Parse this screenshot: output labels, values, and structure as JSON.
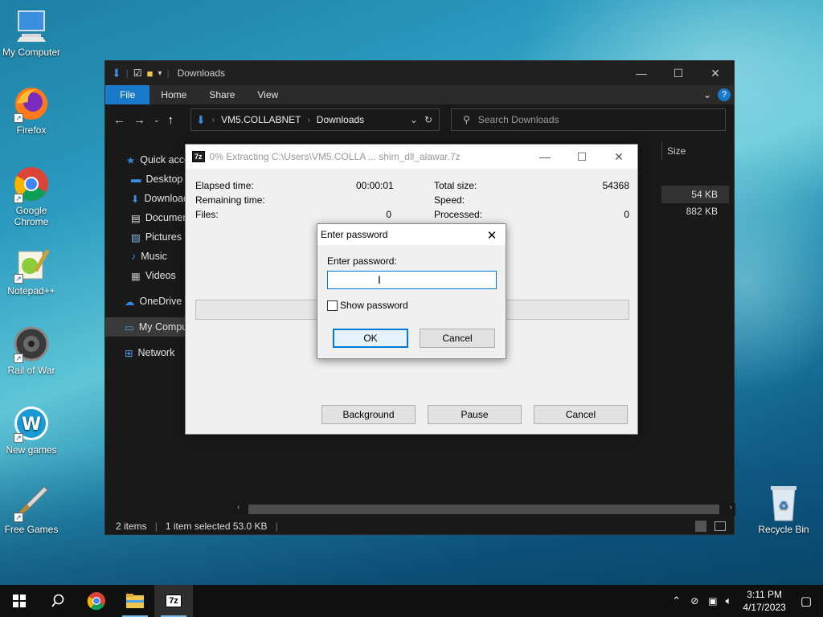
{
  "desktop": {
    "icons": [
      {
        "label": "My Computer"
      },
      {
        "label": "Firefox"
      },
      {
        "label": "Google Chrome"
      },
      {
        "label": "Notepad++"
      },
      {
        "label": "Rail of War"
      },
      {
        "label": "New games"
      },
      {
        "label": "Free Games"
      },
      {
        "label": "Recycle Bin"
      }
    ]
  },
  "explorer": {
    "title": "Downloads",
    "ribbon_tabs": [
      "File",
      "Home",
      "Share",
      "View"
    ],
    "breadcrumb": [
      "VM5.COLLABNET",
      "Downloads"
    ],
    "search_placeholder": "Search Downloads",
    "nav_items": [
      "Quick access",
      "Desktop",
      "Downloads",
      "Documents",
      "Pictures",
      "Music",
      "Videos",
      "OneDrive",
      "My Computer",
      "Network"
    ],
    "column_size": "Size",
    "file_sizes": [
      "54 KB",
      "882 KB"
    ],
    "status": {
      "items": "2 items",
      "selected": "1 item selected  53.0 KB"
    }
  },
  "extract": {
    "title": "0% Extracting C:\\Users\\VM5.COLLA ... shim_dll_alawar.7z",
    "logo": "7z",
    "elapsed_label": "Elapsed time:",
    "elapsed_value": "00:00:01",
    "remaining_label": "Remaining time:",
    "files_label": "Files:",
    "files_value": "0",
    "total_label": "Total size:",
    "total_value": "54368",
    "speed_label": "Speed:",
    "processed_label": "Processed:",
    "processed_value": "0",
    "buttons": {
      "background": "Background",
      "pause": "Pause",
      "cancel": "Cancel"
    },
    "progress": 0
  },
  "password_dialog": {
    "title": "Enter password",
    "field_label": "Enter password:",
    "value": "",
    "show_password_label": "Show password",
    "ok_label": "OK",
    "cancel_label": "Cancel"
  },
  "taskbar": {
    "time": "3:11 PM",
    "date": "4/17/2023"
  }
}
